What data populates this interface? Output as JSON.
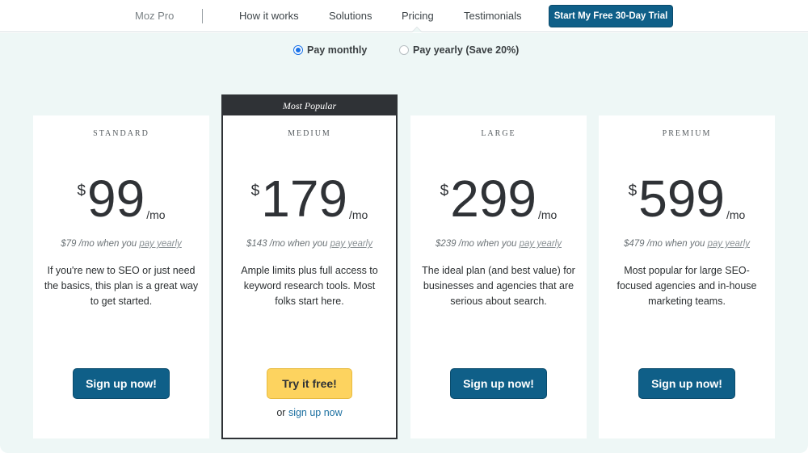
{
  "nav": {
    "brand": "Moz Pro",
    "links": [
      "How it works",
      "Solutions",
      "Pricing",
      "Testimonials"
    ],
    "active": "Pricing",
    "trial_button": "Start My Free 30-Day Trial"
  },
  "billing": {
    "monthly_label": "Pay monthly",
    "yearly_label": "Pay yearly (Save 20%)",
    "selected": "monthly"
  },
  "plans": [
    {
      "tier": "STANDARD",
      "currency": "$",
      "price": "99",
      "per": "/mo",
      "yearly_price": "$79 /mo when you",
      "yearly_link": "pay yearly",
      "description": "If you're new to SEO or just need the basics, this plan is a great way to get started.",
      "cta": "Sign up now!"
    },
    {
      "ribbon": "Most Popular",
      "tier": "MEDIUM",
      "currency": "$",
      "price": "179",
      "per": "/mo",
      "yearly_price": "$143 /mo when you",
      "yearly_link": "pay yearly",
      "description": "Ample limits plus full access to keyword research tools. Most folks start here.",
      "cta": "Try it free!",
      "secondary_prefix": "or",
      "secondary_link": "sign up now"
    },
    {
      "tier": "LARGE",
      "currency": "$",
      "price": "299",
      "per": "/mo",
      "yearly_price": "$239 /mo when you",
      "yearly_link": "pay yearly",
      "description": "The ideal plan (and best value) for businesses and agencies that are serious about search.",
      "cta": "Sign up now!"
    },
    {
      "tier": "PREMIUM",
      "currency": "$",
      "price": "599",
      "per": "/mo",
      "yearly_price": "$479 /mo when you",
      "yearly_link": "pay yearly",
      "description": "Most popular for large SEO-focused agencies and in-house marketing teams.",
      "cta": "Sign up now!"
    }
  ],
  "colors": {
    "primary_button": "#0f5f88",
    "featured_button": "#fdd35f",
    "page_background": "#eef7f6",
    "featured_border": "#2f3236"
  }
}
